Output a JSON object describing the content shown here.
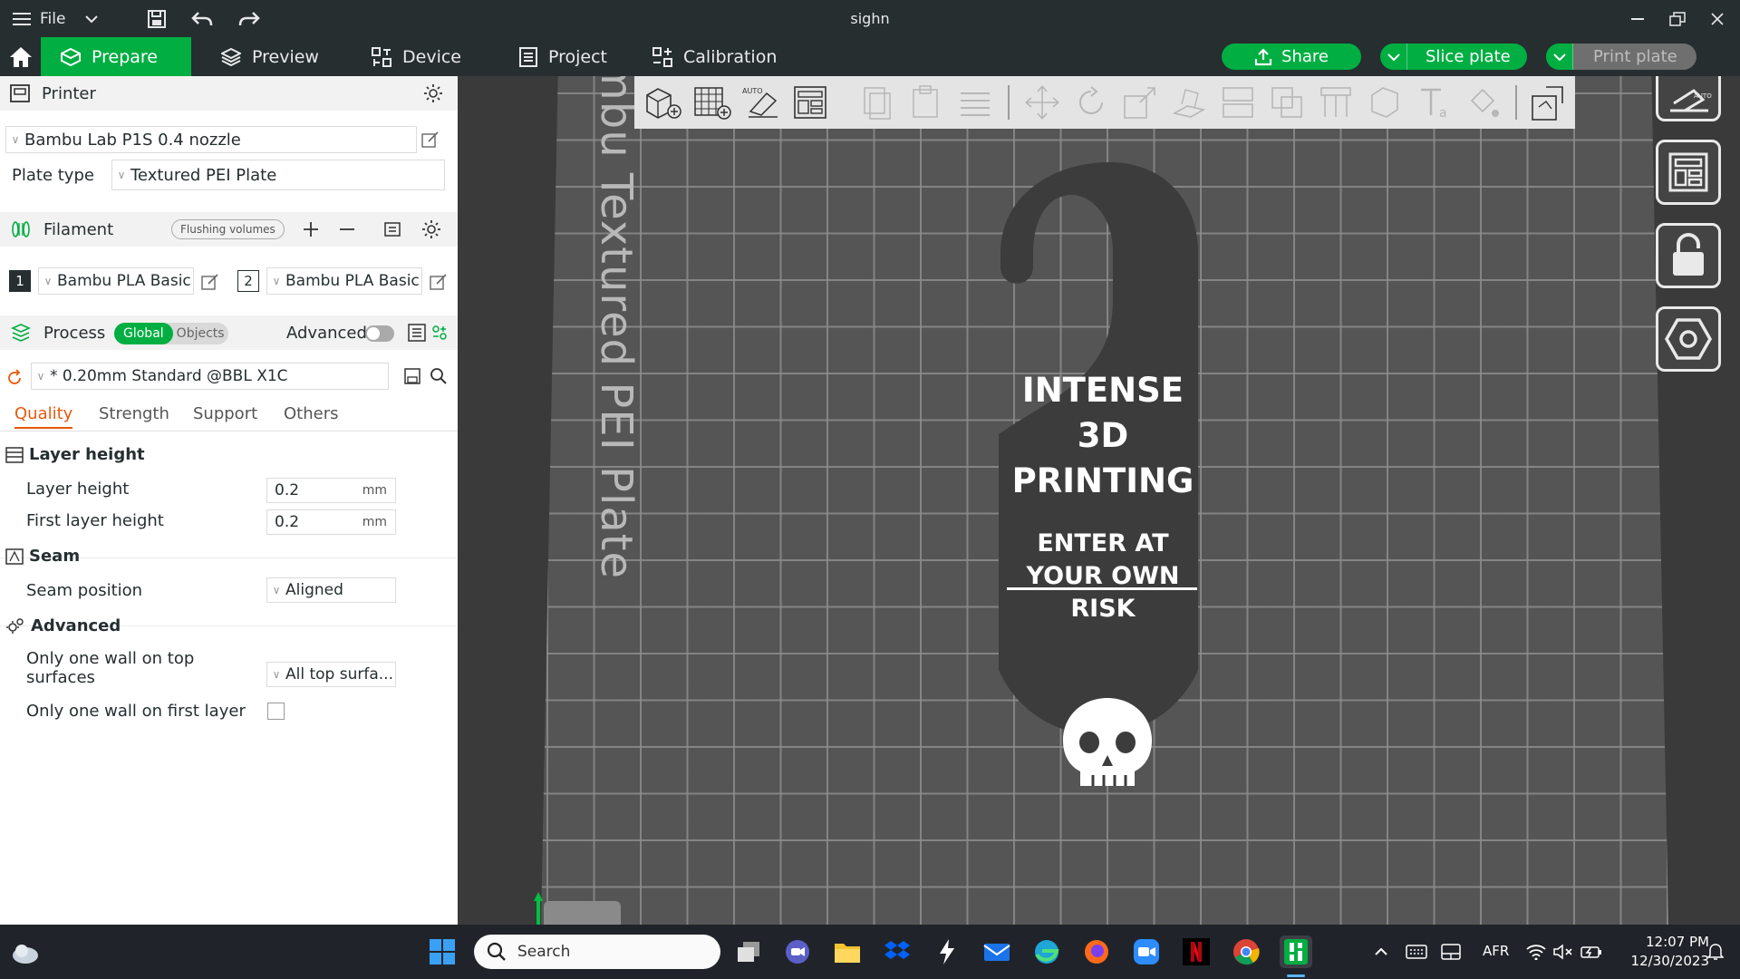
{
  "titlebar": {
    "file_menu": "File",
    "title": "sighn"
  },
  "nav": {
    "tabs": [
      {
        "label": "Prepare"
      },
      {
        "label": "Preview"
      },
      {
        "label": "Device"
      },
      {
        "label": "Project"
      },
      {
        "label": "Calibration"
      }
    ],
    "share": "Share",
    "slice": "Slice plate",
    "print": "Print plate"
  },
  "printer": {
    "section": "Printer",
    "model": "Bambu Lab P1S 0.4 nozzle",
    "plate_type_label": "Plate type",
    "plate_type": "Textured PEI Plate"
  },
  "filament": {
    "section": "Filament",
    "flushing": "Flushing volumes",
    "slots": [
      {
        "index": "1",
        "name": "Bambu PLA Basic"
      },
      {
        "index": "2",
        "name": "Bambu PLA Basic"
      }
    ]
  },
  "process": {
    "section": "Process",
    "global": "Global",
    "objects": "Objects",
    "advanced": "Advanced",
    "preset": "* 0.20mm Standard @BBL X1C",
    "tabs": [
      "Quality",
      "Strength",
      "Support",
      "Others"
    ]
  },
  "quality": {
    "group_layer": "Layer height",
    "layer_height_label": "Layer height",
    "layer_height": "0.2",
    "first_layer_label": "First layer height",
    "first_layer": "0.2",
    "unit": "mm",
    "group_seam": "Seam",
    "seam_label": "Seam position",
    "seam_value": "Aligned",
    "group_advanced": "Advanced",
    "one_wall_top_label": "Only one wall on top surfaces",
    "one_wall_top_value": "All top surfa...",
    "one_wall_first_label": "Only one wall on first layer"
  },
  "viewport": {
    "plate_label": "mbu Textured PEI Plate",
    "tag_line1": "INTENSE",
    "tag_line2": "3D",
    "tag_line3": "PRINTING",
    "tag_sub1": "ENTER AT",
    "tag_sub2": "YOUR OWN",
    "tag_sub3": "RISK"
  },
  "taskbar": {
    "search": "Search",
    "lang": "AFR",
    "time": "12:07 PM",
    "date": "12/30/2023"
  },
  "colors": {
    "accent": "#00ae42",
    "dark": "#262e30",
    "warning": "#e8590c"
  }
}
